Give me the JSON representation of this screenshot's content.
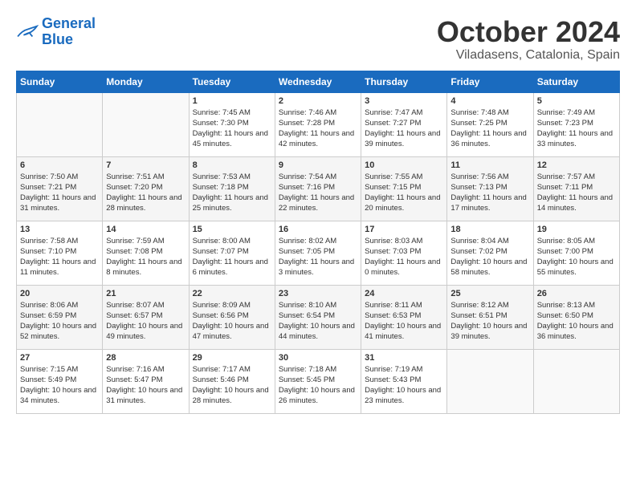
{
  "header": {
    "logo_line1": "General",
    "logo_line2": "Blue",
    "month": "October 2024",
    "location": "Viladasens, Catalonia, Spain"
  },
  "weekdays": [
    "Sunday",
    "Monday",
    "Tuesday",
    "Wednesday",
    "Thursday",
    "Friday",
    "Saturday"
  ],
  "weeks": [
    [
      {
        "day": "",
        "sunrise": "",
        "sunset": "",
        "daylight": ""
      },
      {
        "day": "",
        "sunrise": "",
        "sunset": "",
        "daylight": ""
      },
      {
        "day": "1",
        "sunrise": "Sunrise: 7:45 AM",
        "sunset": "Sunset: 7:30 PM",
        "daylight": "Daylight: 11 hours and 45 minutes."
      },
      {
        "day": "2",
        "sunrise": "Sunrise: 7:46 AM",
        "sunset": "Sunset: 7:28 PM",
        "daylight": "Daylight: 11 hours and 42 minutes."
      },
      {
        "day": "3",
        "sunrise": "Sunrise: 7:47 AM",
        "sunset": "Sunset: 7:27 PM",
        "daylight": "Daylight: 11 hours and 39 minutes."
      },
      {
        "day": "4",
        "sunrise": "Sunrise: 7:48 AM",
        "sunset": "Sunset: 7:25 PM",
        "daylight": "Daylight: 11 hours and 36 minutes."
      },
      {
        "day": "5",
        "sunrise": "Sunrise: 7:49 AM",
        "sunset": "Sunset: 7:23 PM",
        "daylight": "Daylight: 11 hours and 33 minutes."
      }
    ],
    [
      {
        "day": "6",
        "sunrise": "Sunrise: 7:50 AM",
        "sunset": "Sunset: 7:21 PM",
        "daylight": "Daylight: 11 hours and 31 minutes."
      },
      {
        "day": "7",
        "sunrise": "Sunrise: 7:51 AM",
        "sunset": "Sunset: 7:20 PM",
        "daylight": "Daylight: 11 hours and 28 minutes."
      },
      {
        "day": "8",
        "sunrise": "Sunrise: 7:53 AM",
        "sunset": "Sunset: 7:18 PM",
        "daylight": "Daylight: 11 hours and 25 minutes."
      },
      {
        "day": "9",
        "sunrise": "Sunrise: 7:54 AM",
        "sunset": "Sunset: 7:16 PM",
        "daylight": "Daylight: 11 hours and 22 minutes."
      },
      {
        "day": "10",
        "sunrise": "Sunrise: 7:55 AM",
        "sunset": "Sunset: 7:15 PM",
        "daylight": "Daylight: 11 hours and 20 minutes."
      },
      {
        "day": "11",
        "sunrise": "Sunrise: 7:56 AM",
        "sunset": "Sunset: 7:13 PM",
        "daylight": "Daylight: 11 hours and 17 minutes."
      },
      {
        "day": "12",
        "sunrise": "Sunrise: 7:57 AM",
        "sunset": "Sunset: 7:11 PM",
        "daylight": "Daylight: 11 hours and 14 minutes."
      }
    ],
    [
      {
        "day": "13",
        "sunrise": "Sunrise: 7:58 AM",
        "sunset": "Sunset: 7:10 PM",
        "daylight": "Daylight: 11 hours and 11 minutes."
      },
      {
        "day": "14",
        "sunrise": "Sunrise: 7:59 AM",
        "sunset": "Sunset: 7:08 PM",
        "daylight": "Daylight: 11 hours and 8 minutes."
      },
      {
        "day": "15",
        "sunrise": "Sunrise: 8:00 AM",
        "sunset": "Sunset: 7:07 PM",
        "daylight": "Daylight: 11 hours and 6 minutes."
      },
      {
        "day": "16",
        "sunrise": "Sunrise: 8:02 AM",
        "sunset": "Sunset: 7:05 PM",
        "daylight": "Daylight: 11 hours and 3 minutes."
      },
      {
        "day": "17",
        "sunrise": "Sunrise: 8:03 AM",
        "sunset": "Sunset: 7:03 PM",
        "daylight": "Daylight: 11 hours and 0 minutes."
      },
      {
        "day": "18",
        "sunrise": "Sunrise: 8:04 AM",
        "sunset": "Sunset: 7:02 PM",
        "daylight": "Daylight: 10 hours and 58 minutes."
      },
      {
        "day": "19",
        "sunrise": "Sunrise: 8:05 AM",
        "sunset": "Sunset: 7:00 PM",
        "daylight": "Daylight: 10 hours and 55 minutes."
      }
    ],
    [
      {
        "day": "20",
        "sunrise": "Sunrise: 8:06 AM",
        "sunset": "Sunset: 6:59 PM",
        "daylight": "Daylight: 10 hours and 52 minutes."
      },
      {
        "day": "21",
        "sunrise": "Sunrise: 8:07 AM",
        "sunset": "Sunset: 6:57 PM",
        "daylight": "Daylight: 10 hours and 49 minutes."
      },
      {
        "day": "22",
        "sunrise": "Sunrise: 8:09 AM",
        "sunset": "Sunset: 6:56 PM",
        "daylight": "Daylight: 10 hours and 47 minutes."
      },
      {
        "day": "23",
        "sunrise": "Sunrise: 8:10 AM",
        "sunset": "Sunset: 6:54 PM",
        "daylight": "Daylight: 10 hours and 44 minutes."
      },
      {
        "day": "24",
        "sunrise": "Sunrise: 8:11 AM",
        "sunset": "Sunset: 6:53 PM",
        "daylight": "Daylight: 10 hours and 41 minutes."
      },
      {
        "day": "25",
        "sunrise": "Sunrise: 8:12 AM",
        "sunset": "Sunset: 6:51 PM",
        "daylight": "Daylight: 10 hours and 39 minutes."
      },
      {
        "day": "26",
        "sunrise": "Sunrise: 8:13 AM",
        "sunset": "Sunset: 6:50 PM",
        "daylight": "Daylight: 10 hours and 36 minutes."
      }
    ],
    [
      {
        "day": "27",
        "sunrise": "Sunrise: 7:15 AM",
        "sunset": "Sunset: 5:49 PM",
        "daylight": "Daylight: 10 hours and 34 minutes."
      },
      {
        "day": "28",
        "sunrise": "Sunrise: 7:16 AM",
        "sunset": "Sunset: 5:47 PM",
        "daylight": "Daylight: 10 hours and 31 minutes."
      },
      {
        "day": "29",
        "sunrise": "Sunrise: 7:17 AM",
        "sunset": "Sunset: 5:46 PM",
        "daylight": "Daylight: 10 hours and 28 minutes."
      },
      {
        "day": "30",
        "sunrise": "Sunrise: 7:18 AM",
        "sunset": "Sunset: 5:45 PM",
        "daylight": "Daylight: 10 hours and 26 minutes."
      },
      {
        "day": "31",
        "sunrise": "Sunrise: 7:19 AM",
        "sunset": "Sunset: 5:43 PM",
        "daylight": "Daylight: 10 hours and 23 minutes."
      },
      {
        "day": "",
        "sunrise": "",
        "sunset": "",
        "daylight": ""
      },
      {
        "day": "",
        "sunrise": "",
        "sunset": "",
        "daylight": ""
      }
    ]
  ]
}
